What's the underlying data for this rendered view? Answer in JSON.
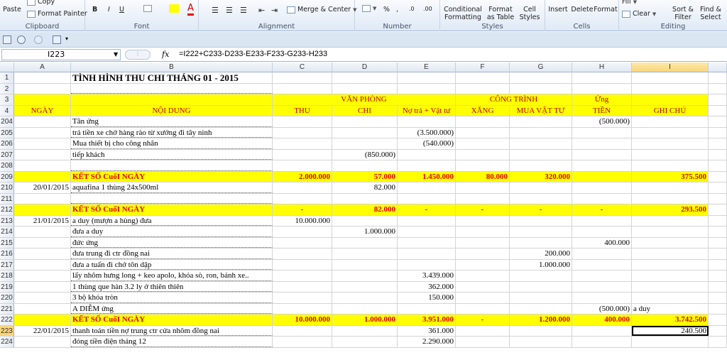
{
  "ribbon": {
    "clipboard": {
      "paste": "Paste",
      "copy": "Copy",
      "format_painter": "Format Painter",
      "label": "Clipboard"
    },
    "font": {
      "bold": "B",
      "italic": "I",
      "underline": "U",
      "font_color": "A",
      "label": "Font"
    },
    "alignment": {
      "merge": "Merge & Center",
      "label": "Alignment"
    },
    "number": {
      "percent": "%",
      "comma": ",",
      "inc": ".0",
      "dec": ".00",
      "label": "Number"
    },
    "styles": {
      "cond": "Conditional Formatting",
      "table": "Format as Table",
      "cell": "Cell Styles",
      "label": "Styles"
    },
    "cells": {
      "insert": "Insert",
      "delete": "Delete",
      "format": "Format",
      "label": "Cells"
    },
    "editing": {
      "fill": "Fill",
      "clear": "Clear",
      "sort": "Sort & Filter",
      "find": "Find & Select",
      "label": "Editing"
    }
  },
  "formula_bar": {
    "name_box": "I223",
    "fx": "fx",
    "formula": "=I222+C233-D233-E233-F233-G233-H233"
  },
  "columns": [
    {
      "id": "A",
      "label": "A"
    },
    {
      "id": "B",
      "label": "B"
    },
    {
      "id": "C",
      "label": "C"
    },
    {
      "id": "D",
      "label": "D"
    },
    {
      "id": "E",
      "label": "E"
    },
    {
      "id": "F",
      "label": "F"
    },
    {
      "id": "G",
      "label": "G"
    },
    {
      "id": "H",
      "label": "H"
    },
    {
      "id": "I",
      "label": "I"
    }
  ],
  "rows": [
    {
      "n": "1",
      "cells": {
        "B": "TÌNH HÌNH THU CHI THÁNG 01 - 2015"
      }
    },
    {
      "n": "2",
      "cells": {}
    },
    {
      "n": "3",
      "cells": {
        "CE": "VĂN PHÒNG",
        "FG": "CÔNG TRÌNH",
        "H": "Ứng"
      }
    },
    {
      "n": "4",
      "cells": {
        "A": "NGÀY",
        "B": "NỘI DUNG",
        "C": "THU",
        "D": "CHI",
        "E": "Nợ trả + Vật tư",
        "F": "XĂNG",
        "G": "MUA VẬT TƯ",
        "H": "TIỀN",
        "I": "GHI CHÚ"
      }
    },
    {
      "n": "204",
      "cells": {
        "B": "Tân ứng",
        "H": "(500.000)"
      }
    },
    {
      "n": "205",
      "cells": {
        "B": "trả tiền xe chở hàng rào từ xưởng đi tây ninh",
        "E": "(3.500.000)"
      }
    },
    {
      "n": "206",
      "cells": {
        "B": "Mua thiết bị cho công nhân",
        "E": "(540.000)"
      }
    },
    {
      "n": "207",
      "cells": {
        "B": "tiếp khách",
        "D": "(850.000)"
      }
    },
    {
      "n": "208",
      "cells": {}
    },
    {
      "n": "209",
      "total": true,
      "cells": {
        "B": "KẾT SỐ CuốI NGÀY",
        "C": "2.000.000",
        "D": "57.000",
        "E": "1.450.000",
        "F": "80.000",
        "G": "320.000",
        "I": "375.500"
      }
    },
    {
      "n": "210",
      "cells": {
        "A": "20/01/2015",
        "B": "aquafina 1 thùng 24x500ml",
        "D": "82.000"
      }
    },
    {
      "n": "211",
      "cells": {}
    },
    {
      "n": "212",
      "total": true,
      "cells": {
        "B": "KẾT SỐ CuốI NGÀY",
        "C": "-",
        "D": "82.000",
        "E": "-",
        "F": "-",
        "G": "-",
        "H": "-",
        "I": "293.500"
      }
    },
    {
      "n": "213",
      "cells": {
        "A": "21/01/2015",
        "B": "a duy (mượn a hùng) đưa",
        "C": "10.000.000"
      }
    },
    {
      "n": "214",
      "cells": {
        "B": "đưa a duy",
        "D": "1.000.000"
      }
    },
    {
      "n": "215",
      "cells": {
        "B": "đức ứng",
        "H": "400.000"
      }
    },
    {
      "n": "216",
      "cells": {
        "B": "đưa trung đi ctr đồng nai",
        "G": "200.000"
      }
    },
    {
      "n": "217",
      "cells": {
        "B": "đưa a tuấn đi chở tôn dập",
        "G": "1.000.000"
      }
    },
    {
      "n": "218",
      "cells": {
        "B": "lấy nhôm hưng long + keo apolo, khóa sò, ron, bánh xe..",
        "E": "3.439.000"
      }
    },
    {
      "n": "219",
      "cells": {
        "B": "1 thùng que hàn 3.2 ly ở thiên thiên",
        "E": "362.000"
      }
    },
    {
      "n": "220",
      "cells": {
        "B": "3 bộ khóa tròn",
        "E": "150.000"
      }
    },
    {
      "n": "221",
      "cells": {
        "B": "A DIỄM ứng",
        "H": "(500.000)",
        "I": "a duy"
      }
    },
    {
      "n": "222",
      "total": true,
      "cells": {
        "B": "KẾT SỐ CuốI NGÀY",
        "C": "10.000.000",
        "D": "1.000.000",
        "E": "3.951.000",
        "F": "-",
        "G": "1.200.000",
        "H": "400.000",
        "I": "3.742.500"
      }
    },
    {
      "n": "223",
      "selected": true,
      "cells": {
        "A": "22/01/2015",
        "B": "thanh toán tiền nợ trung ctr cửa nhôm đồng nai",
        "E": "361.000",
        "I": "240.500"
      }
    },
    {
      "n": "224",
      "cells": {
        "B": "đóng tiền điện tháng 12",
        "E": "2.290.000"
      }
    }
  ],
  "colors": {
    "total_fill": "#ffff00",
    "total_text": "#e00000",
    "selection": "#217346"
  }
}
